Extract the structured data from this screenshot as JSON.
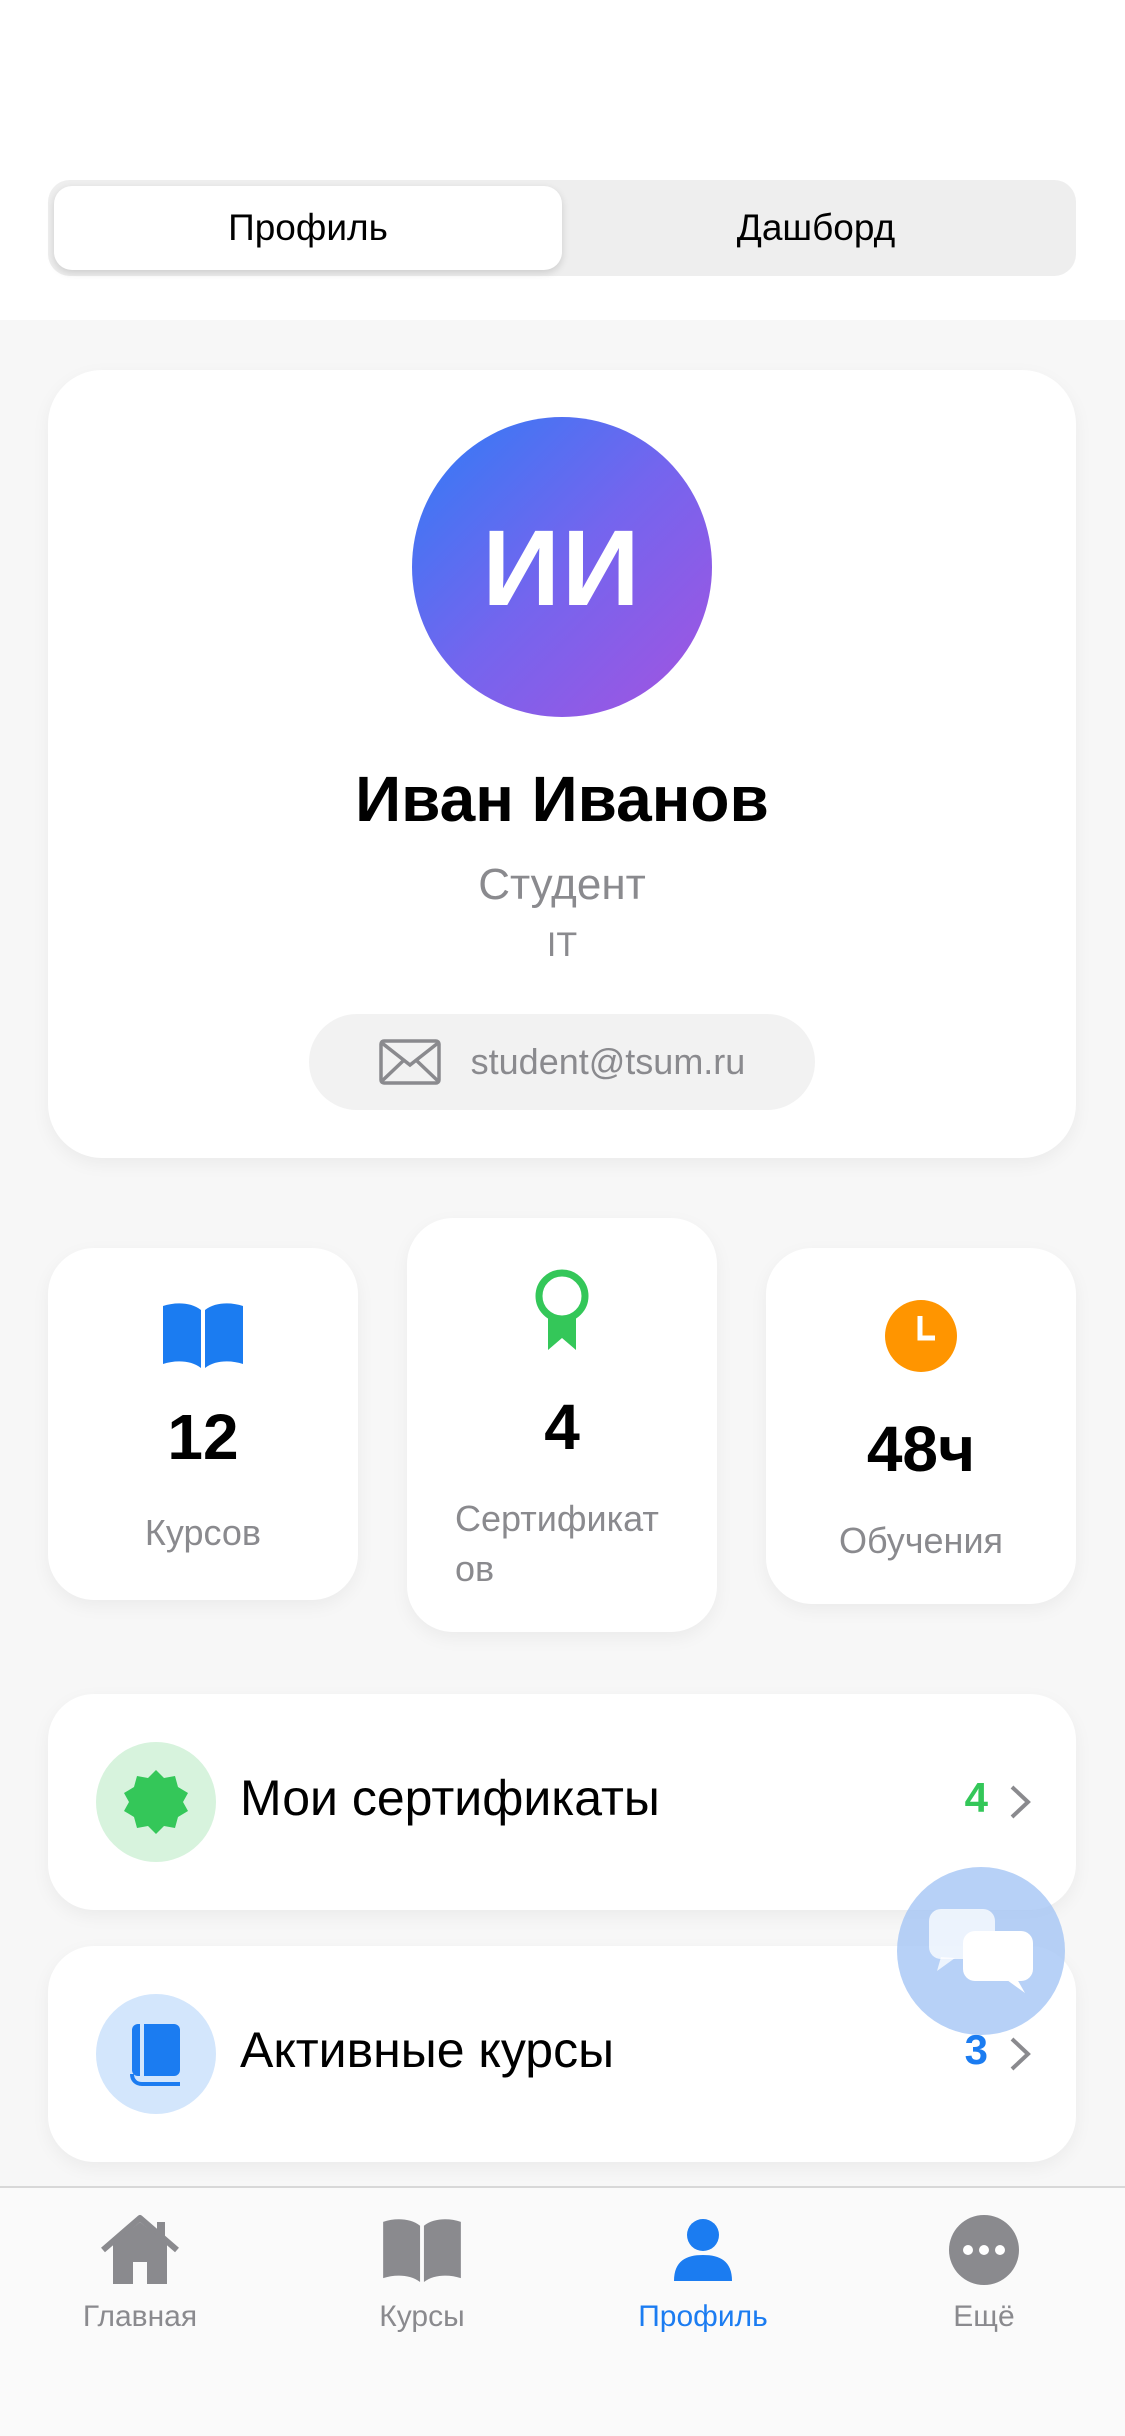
{
  "segmented": {
    "profile_label": "Профиль",
    "dashboard_label": "Дашборд"
  },
  "profile": {
    "initials": "ИИ",
    "name": "Иван Иванов",
    "role": "Студент",
    "department": "IT",
    "email": "student@tsum.ru"
  },
  "stats": {
    "courses": {
      "value": "12",
      "label": "Курсов",
      "icon": "book-icon",
      "color": "#1b7cf1"
    },
    "certificates": {
      "value": "4",
      "label_line1": "Сертификат",
      "label_line2": "ов",
      "icon": "award-ribbon-icon",
      "color": "#34c759"
    },
    "learning": {
      "value": "48ч",
      "label": "Обучения",
      "icon": "clock-icon",
      "color": "#ff9500"
    }
  },
  "rows": {
    "certificates": {
      "title": "Мои сертификаты",
      "count": "4",
      "icon": "seal-badge-icon",
      "color": "#34c759"
    },
    "active_courses": {
      "title": "Активные курсы",
      "count": "3",
      "icon": "book-closed-icon",
      "color": "#1b7cf1"
    }
  },
  "chat_button": {
    "icon": "chat-bubbles-icon"
  },
  "tabbar": {
    "home": {
      "label": "Главная",
      "icon": "house-icon"
    },
    "courses": {
      "label": "Курсы",
      "icon": "open-book-icon"
    },
    "profile": {
      "label": "Профиль",
      "icon": "person-icon"
    },
    "more": {
      "label": "Ещё",
      "icon": "ellipsis-circle-icon"
    }
  },
  "colors": {
    "accent": "#1b7cf1",
    "green": "#34c759",
    "orange": "#ff9500",
    "muted": "#8a8a8e"
  }
}
